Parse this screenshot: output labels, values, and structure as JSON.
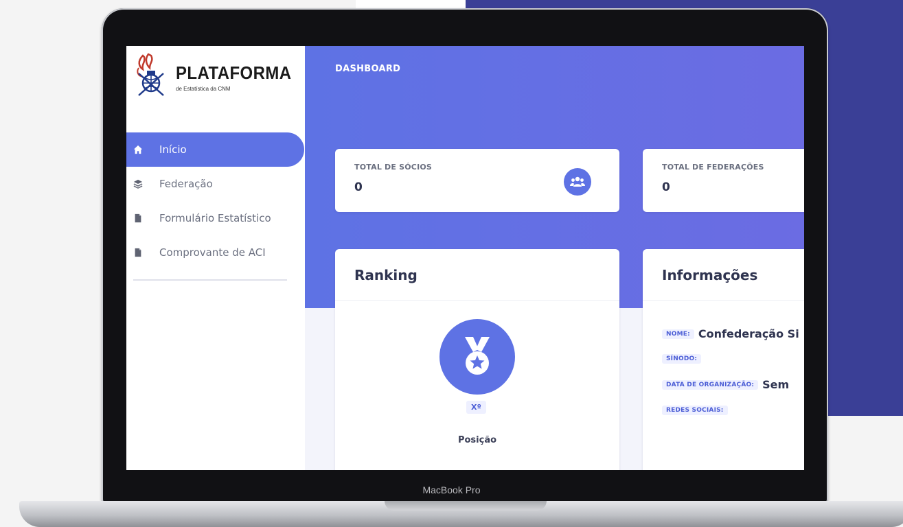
{
  "device": {
    "model_label": "MacBook Pro"
  },
  "brand": {
    "name": "PLATAFORMA",
    "subtitle": "de Estatística da CNM"
  },
  "sidebar": {
    "items": [
      {
        "label": "Início",
        "icon": "home-icon",
        "active": true
      },
      {
        "label": "Federação",
        "icon": "layers-icon",
        "active": false
      },
      {
        "label": "Formulário Estatístico",
        "icon": "document-icon",
        "active": false
      },
      {
        "label": "Comprovante de ACI",
        "icon": "document-icon",
        "active": false
      }
    ]
  },
  "header": {
    "title": "DASHBOARD"
  },
  "stats": [
    {
      "label": "TOTAL DE SÓCIOS",
      "value": "0",
      "icon": "users-icon"
    },
    {
      "label": "TOTAL DE FEDERAÇÕES",
      "value": "0"
    }
  ],
  "ranking": {
    "title": "Ranking",
    "icon": "medal-icon",
    "position_badge": "Xº",
    "position_label": "Posição"
  },
  "info": {
    "title": "Informações",
    "rows": [
      {
        "label": "NOME:",
        "value": "Confederação Si"
      },
      {
        "label": "SÍNODO:",
        "value": ""
      },
      {
        "label": "DATA DE ORGANIZAÇÃO:",
        "value": "Sem"
      },
      {
        "label": "REDES SOCIAIS:",
        "value": ""
      }
    ]
  },
  "colors": {
    "primary": "#5e72e4",
    "background_navy": "#3a3f96",
    "text_dark": "#2f3450",
    "text_muted": "#6b7080"
  }
}
